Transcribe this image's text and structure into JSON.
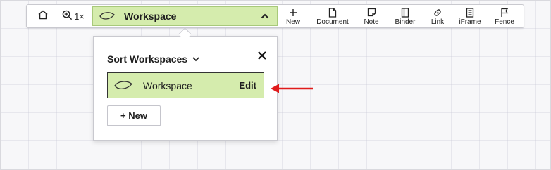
{
  "toolbar": {
    "home_icon": "home-icon",
    "zoom": {
      "icon": "zoom-in-icon",
      "label": "1×"
    },
    "workspace": {
      "icon": "leaf-icon",
      "label": "Workspace",
      "chevron": "chevron-up-icon"
    },
    "tools": [
      {
        "icon": "plus-icon",
        "label": "New"
      },
      {
        "icon": "document-icon",
        "label": "Document"
      },
      {
        "icon": "note-icon",
        "label": "Note"
      },
      {
        "icon": "binder-icon",
        "label": "Binder"
      },
      {
        "icon": "link-icon",
        "label": "Link"
      },
      {
        "icon": "iframe-icon",
        "label": "iFrame"
      },
      {
        "icon": "flag-icon",
        "label": "Fence"
      }
    ]
  },
  "popover": {
    "title": "Sort Workspaces",
    "title_icon": "chevron-down-icon",
    "close_icon": "close-icon",
    "workspaces": [
      {
        "icon": "leaf-icon",
        "name": "Workspace",
        "action": "Edit"
      }
    ],
    "new_button": "+ New"
  },
  "annotation": {
    "icon": "red-arrow-left",
    "color": "#e01b1b"
  },
  "colors": {
    "accent_green": "#d5ecad",
    "accent_border": "#a8c97a"
  }
}
